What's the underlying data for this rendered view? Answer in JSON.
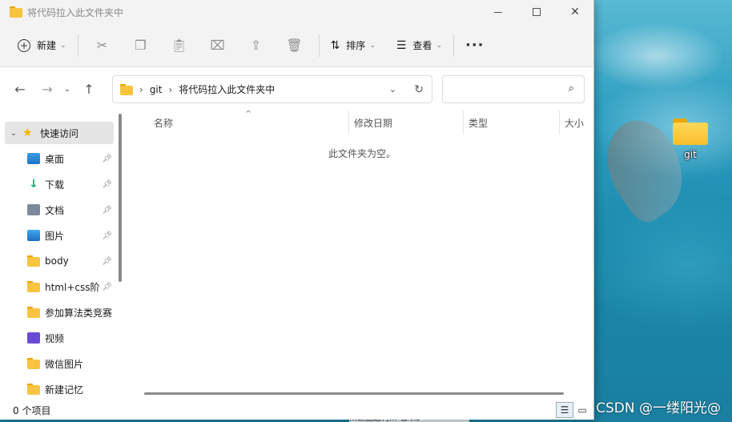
{
  "window": {
    "title": "将代码拉入此文件夹中"
  },
  "toolbar": {
    "new_label": "新建",
    "sort_label": "排序",
    "view_label": "查看",
    "icons": [
      "cut-icon",
      "copy-icon",
      "paste-icon",
      "rename-icon",
      "share-icon",
      "delete-icon"
    ]
  },
  "address": {
    "crumbs": [
      "git",
      "将代码拉入此文件夹中"
    ]
  },
  "search": {
    "value": "",
    "placeholder": ""
  },
  "sidebar": {
    "quick_access": "快速访问",
    "items": [
      {
        "label": "桌面",
        "icon": "desktop-icon",
        "pinned": true
      },
      {
        "label": "下载",
        "icon": "download-icon",
        "pinned": true
      },
      {
        "label": "文档",
        "icon": "document-icon",
        "pinned": true
      },
      {
        "label": "图片",
        "icon": "pictures-icon",
        "pinned": true
      },
      {
        "label": "body",
        "icon": "folder-icon",
        "pinned": true
      },
      {
        "label": "html+css阶",
        "icon": "folder-icon",
        "pinned": true
      },
      {
        "label": "参加算法类竞赛",
        "icon": "folder-icon",
        "pinned": false
      },
      {
        "label": "视频",
        "icon": "video-icon",
        "pinned": false
      },
      {
        "label": "微信图片",
        "icon": "folder-icon",
        "pinned": false
      },
      {
        "label": "新建记忆",
        "icon": "folder-icon",
        "pinned": false
      }
    ]
  },
  "columns": {
    "name": "名称",
    "modified": "修改日期",
    "type": "类型",
    "size": "大小"
  },
  "content": {
    "empty_message": "此文件夹为空。"
  },
  "status": {
    "count": "0 个项目"
  },
  "desktop": {
    "icon_label": "git",
    "watermark": "CSDN @一缕阳光@",
    "taskbar_text": "…数据结构…  若以s"
  }
}
